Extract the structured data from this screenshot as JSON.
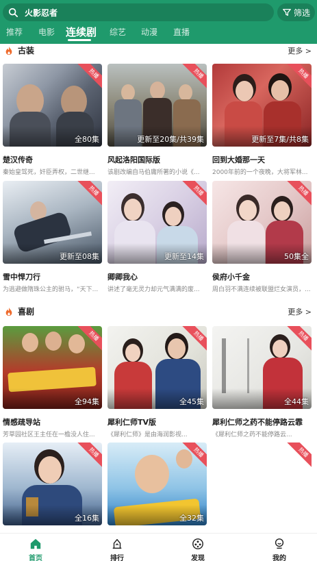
{
  "header": {
    "search_value": "火影忍者",
    "filter_label": "筛选",
    "tabs": [
      {
        "label": "推荐"
      },
      {
        "label": "电影"
      },
      {
        "label": "连续剧"
      },
      {
        "label": "综艺"
      },
      {
        "label": "动漫"
      },
      {
        "label": "直播"
      }
    ],
    "active_tab": "连续剧"
  },
  "sections": [
    {
      "title": "古装",
      "more_label": "更多 >",
      "cards": [
        {
          "title": "楚汉传奇",
          "desc": "秦始皇驾死，奸臣弄权，二世继...",
          "badge": "热播",
          "episodes": "全80集"
        },
        {
          "title": "风起洛阳国际版",
          "desc": "该剧改编自马伯庸所著的小说《...",
          "badge": "热播",
          "episodes": "更新至20集/共39集"
        },
        {
          "title": "回到大婚那一天",
          "desc": "2000年前的一个夜晚，大将军林...",
          "badge": "热播",
          "episodes": "更新至7集/共8集"
        },
        {
          "title": "雪中悍刀行",
          "desc": "为逃避做隋珠公主的驸马，“天下...",
          "badge": "热播",
          "episodes": "更新至08集"
        },
        {
          "title": "卿卿我心",
          "desc": "讲述了毫无灵力却元气满满的废...",
          "badge": "热播",
          "episodes": "更新至14集"
        },
        {
          "title": "侯府小千金",
          "desc": "周白羽不满连续被联盟烂女演员，...",
          "badge": "热播",
          "episodes": "50集全"
        }
      ]
    },
    {
      "title": "喜剧",
      "more_label": "更多 >",
      "cards": [
        {
          "title": "情感疏导站",
          "desc": "芳草园社区王主任在一檐没人住...",
          "badge": "热播",
          "episodes": "全94集"
        },
        {
          "title": "犀利仁师TV版",
          "desc": "《犀利仁师》是由海润影视...",
          "badge": "热播",
          "episodes": "全45集"
        },
        {
          "title": "犀利仁师之药不能停路云霏",
          "desc": "《犀利仁师之药不能停路云...",
          "badge": "热播",
          "episodes": "全44集"
        },
        {
          "title": "",
          "desc": "",
          "badge": "热播",
          "episodes": "全16集"
        },
        {
          "title": "",
          "desc": "",
          "badge": "热播",
          "episodes": "全32集"
        }
      ]
    }
  ],
  "bottom_nav": [
    {
      "label": "首页",
      "icon": "home-icon",
      "active": true
    },
    {
      "label": "排行",
      "icon": "ranking-icon",
      "active": false
    },
    {
      "label": "发现",
      "icon": "discover-icon",
      "active": false
    },
    {
      "label": "我的",
      "icon": "profile-icon",
      "active": false
    }
  ],
  "colors": {
    "brand": "#1f9a6c",
    "badge": "#e8505b",
    "flame": "#ee6b2d"
  }
}
